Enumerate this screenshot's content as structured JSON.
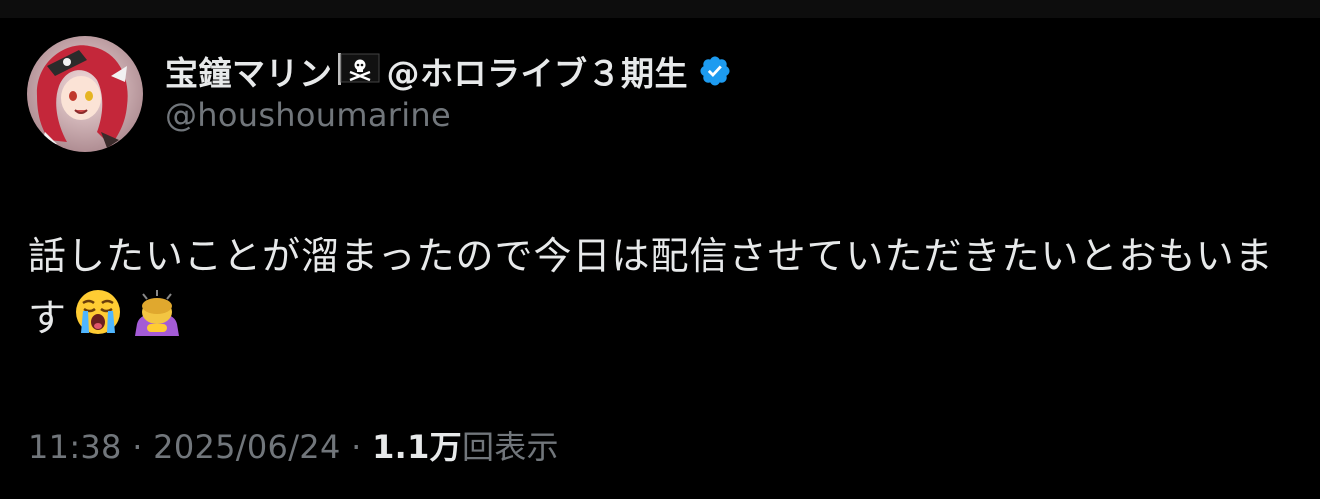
{
  "tweet": {
    "author": {
      "display_name": "宝鐘マリン",
      "display_name_suffix": "@ホロライブ３期生",
      "handle": "@houshoumarine",
      "verified_color": "#1d9bf0"
    },
    "text": "話したいことが溜まったので今日は配信させていただきたいとおもいます",
    "emojis": [
      "crying-face-emoji",
      "person-bowing-emoji"
    ],
    "meta": {
      "time": "11:38",
      "separator": "·",
      "date": "2025/06/24",
      "views_count": "1.1万",
      "views_label": "回表示"
    }
  },
  "colors": {
    "background": "#000000",
    "text_primary": "#e7e9ea",
    "text_secondary": "#71767b"
  }
}
